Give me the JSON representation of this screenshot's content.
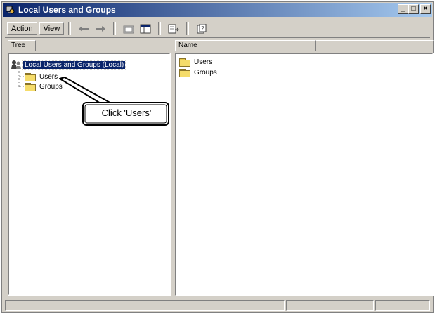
{
  "window": {
    "title": "Local Users and Groups",
    "controls": {
      "minimize": "_",
      "maximize": "□",
      "close": "×"
    }
  },
  "toolbar": {
    "action_label": "Action",
    "view_label": "View"
  },
  "left_pane": {
    "header": "Tree",
    "root_label": "Local Users and Groups (Local)",
    "items": [
      {
        "label": "Users"
      },
      {
        "label": "Groups"
      }
    ]
  },
  "right_pane": {
    "header": "Name",
    "items": [
      {
        "label": "Users"
      },
      {
        "label": "Groups"
      }
    ]
  },
  "callout": {
    "text": "Click 'Users'"
  },
  "colors": {
    "titlebar_start": "#0a246a",
    "titlebar_end": "#a6caf0",
    "window_face": "#d4d0c8",
    "selection": "#0a246a",
    "folder": "#f5dc6a"
  }
}
